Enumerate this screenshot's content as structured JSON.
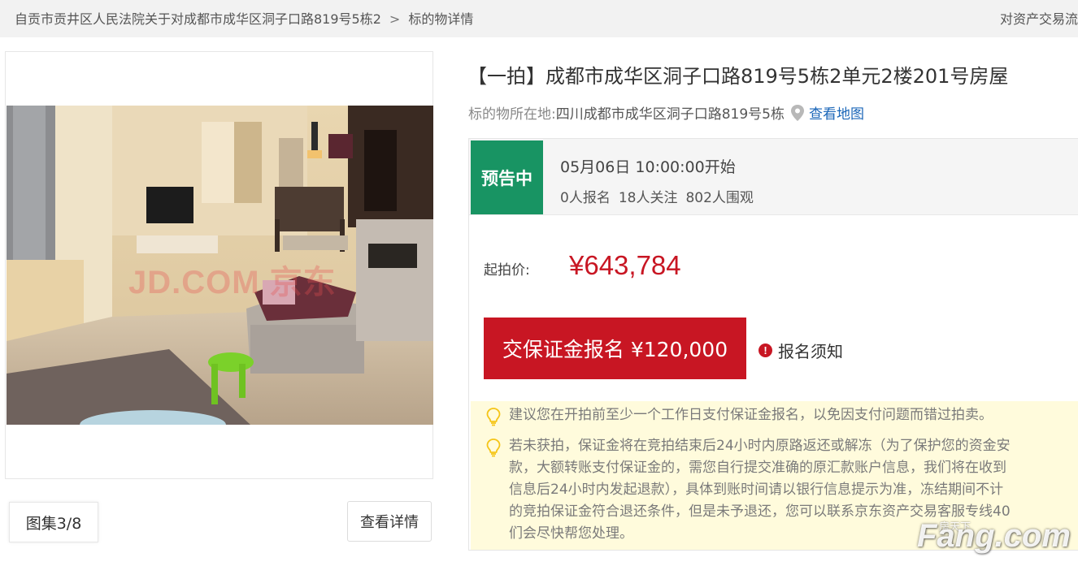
{
  "breadcrumb": {
    "items": [
      "自贡市贡井区人民法院关于对成都市成华区洞子口路819号5栋2",
      "标的物详情"
    ],
    "separator": ">"
  },
  "header_right": "对资产交易流",
  "gallery": {
    "watermark": "JD.COM 京东",
    "album_label": "图集3/8",
    "detail_label": "查看详情"
  },
  "item": {
    "title": "【一拍】成都市成华区洞子口路819号5栋2单元2楼201号房屋",
    "location_label": "标的物所在地:",
    "location": "四川成都市成华区洞子口路819号5栋",
    "map_link": "查看地图"
  },
  "auction": {
    "status": "预告中",
    "start_time": "05月06日 10:00:00开始",
    "signups": "0人报名",
    "followers": "18人关注",
    "viewers": "802人围观",
    "price_label": "起拍价:",
    "price": "¥643,784",
    "deposit_button": "交保证金报名 ¥120,000",
    "notice_link": "报名须知",
    "tip1": "建议您在开拍前至少一个工作日支付保证金报名，以免因支付问题而错过拍卖。",
    "tip2_lines": [
      "若未获拍，保证金将在竞拍结束后24小时内原路返还或解冻（为了保护您的资金安",
      "款，大额转账支付保证金的，需您自行提交准确的原汇款账户信息，我们将在收到",
      "信息后24小时内发起退款），具体到账时间请以银行信息提示为准，冻结期间不计",
      "的竞拍保证金符合退还条件，但是未予退还，您可以联系京东资产交易客服专线40",
      "们会尽快帮您处理。"
    ]
  },
  "watermark_logo": {
    "brand": "Fang.com",
    "sub": "房天下"
  },
  "colors": {
    "accent_red": "#c81623",
    "status_green": "#189463",
    "link_blue": "#1a66b8",
    "tip_bg": "#fffbdc"
  }
}
